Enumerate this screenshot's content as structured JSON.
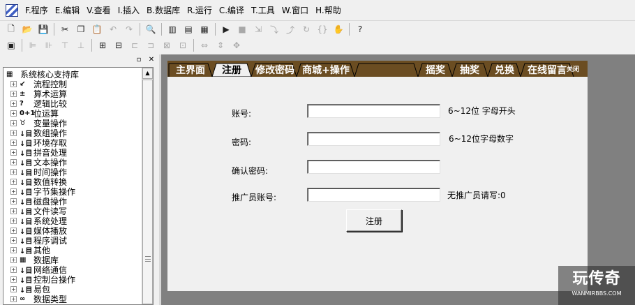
{
  "menubar": {
    "items": [
      "F.程序",
      "E.编辑",
      "V.查看",
      "I.插入",
      "B.数据库",
      "R.运行",
      "C.编译",
      "T.工具",
      "W.窗口",
      "H.帮助"
    ]
  },
  "toolbar1": {
    "icons": [
      "new-file-icon",
      "open-folder-icon",
      "save-icon",
      "cut-icon",
      "copy-icon",
      "paste-icon",
      "undo-icon",
      "redo-icon",
      "find-icon",
      "layout-icon",
      "layout-icon",
      "layout-icon",
      "run-icon",
      "stop-icon",
      "step-icon",
      "step-into-icon",
      "step-out-icon",
      "step-over-icon",
      "breakpoint-icon",
      "hand-icon",
      "help-icon"
    ]
  },
  "tree": {
    "root": "系统核心支持库",
    "items": [
      {
        "icon": "↙",
        "label": "流程控制"
      },
      {
        "icon": "±",
        "label": "算术运算"
      },
      {
        "icon": "?",
        "label": "逻辑比较"
      },
      {
        "icon": "0+1",
        "label": "位运算"
      },
      {
        "icon": "♉",
        "label": "变量操作"
      },
      {
        "icon": "↓目",
        "label": "数组操作"
      },
      {
        "icon": "↓目",
        "label": "环境存取"
      },
      {
        "icon": "↓目",
        "label": "拼音处理"
      },
      {
        "icon": "↓目",
        "label": "文本操作"
      },
      {
        "icon": "↓目",
        "label": "时间操作"
      },
      {
        "icon": "↓目",
        "label": "数值转换"
      },
      {
        "icon": "↓目",
        "label": "字节集操作"
      },
      {
        "icon": "↓目",
        "label": "磁盘操作"
      },
      {
        "icon": "↓目",
        "label": "文件读写"
      },
      {
        "icon": "↓目",
        "label": "系统处理"
      },
      {
        "icon": "↓目",
        "label": "媒体播放"
      },
      {
        "icon": "↓目",
        "label": "程序调试"
      },
      {
        "icon": "↓目",
        "label": "其他"
      },
      {
        "icon": "▦",
        "label": "数据库"
      },
      {
        "icon": "↓目",
        "label": "网络通信"
      },
      {
        "icon": "↓目",
        "label": "控制台操作"
      },
      {
        "icon": "↓目",
        "label": "易包"
      },
      {
        "icon": "∞",
        "label": "数据类型"
      }
    ]
  },
  "form": {
    "tabs": [
      "主界面",
      "注册",
      "修改密码",
      "商城+操作",
      "摇奖",
      "抽奖",
      "兑换",
      "在线留言"
    ],
    "active_tab": "注册",
    "close_label": "关闭",
    "fields": [
      {
        "label": "账号:",
        "value": "",
        "hint": "6~12位 字母开头"
      },
      {
        "label": "密码:",
        "value": "",
        "hint": "6~12位字母数字"
      },
      {
        "label": "确认密码:",
        "value": "",
        "hint": ""
      },
      {
        "label": "推广员账号:",
        "value": "",
        "hint": "无推广员请写:0"
      }
    ],
    "submit_label": "注册",
    "tab_bar_color": "#6b4d22"
  },
  "watermark": {
    "title": "玩传奇",
    "url": "WANMIRBBS.COM"
  }
}
